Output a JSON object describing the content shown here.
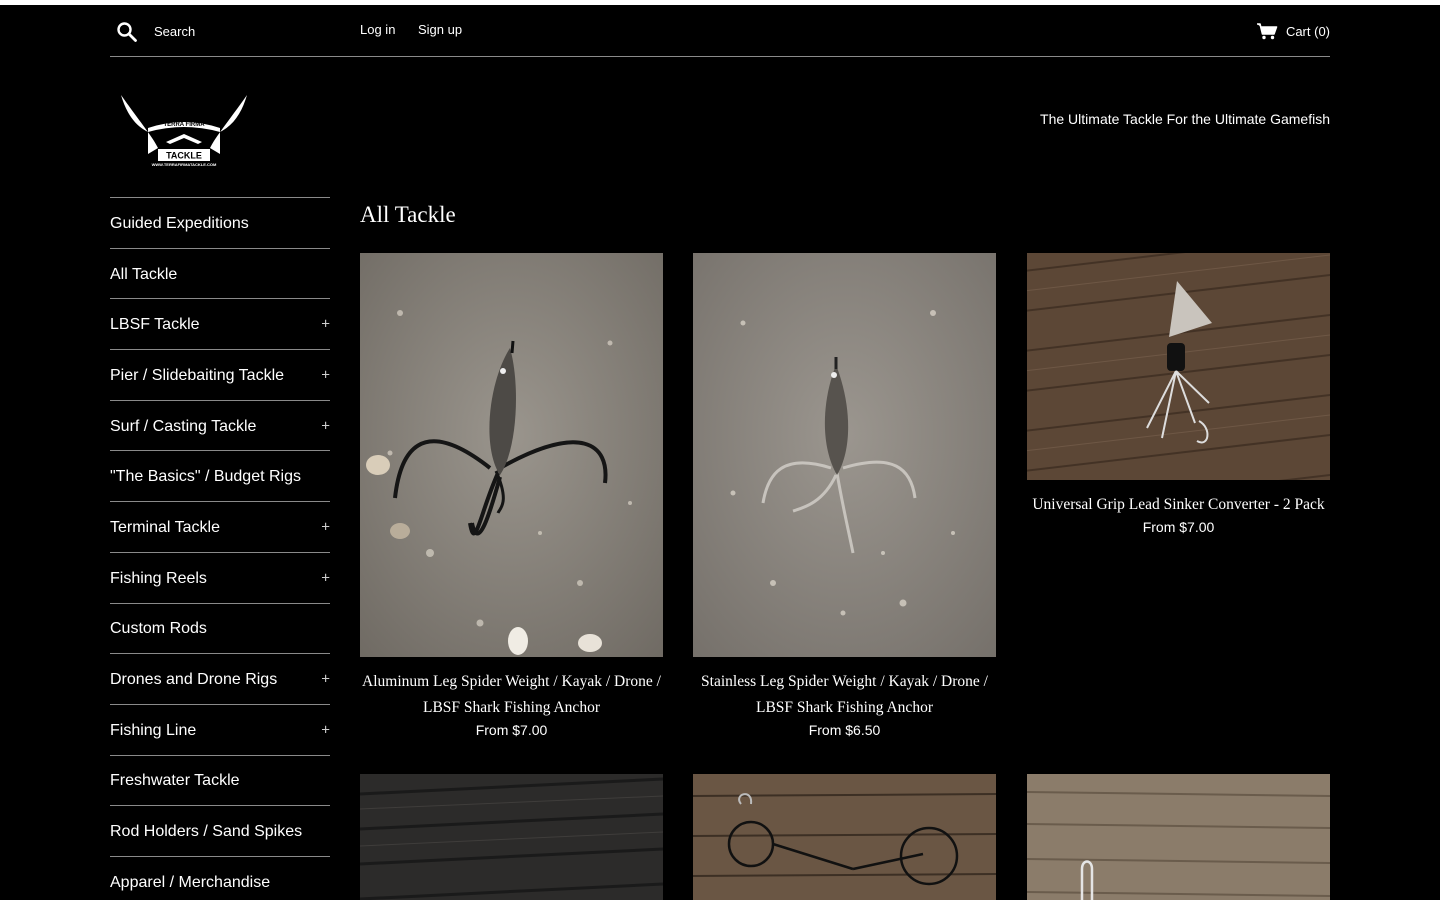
{
  "header": {
    "search_placeholder": "Search",
    "login": "Log in",
    "signup": "Sign up",
    "cart": "Cart (0)"
  },
  "brand": {
    "logo_line1": "TERRA FIRMA",
    "logo_line2": "TACKLE",
    "logo_url_text": "WWW.TERRAFIRMATACKLE.COM",
    "tagline": "The Ultimate Tackle For the Ultimate Gamefish"
  },
  "sidebar": {
    "items": [
      {
        "label": "Guided Expeditions",
        "expandable": false
      },
      {
        "label": "All Tackle",
        "expandable": false
      },
      {
        "label": "LBSF Tackle",
        "expandable": true
      },
      {
        "label": "Pier / Slidebaiting Tackle",
        "expandable": true
      },
      {
        "label": "Surf / Casting Tackle",
        "expandable": true
      },
      {
        "label": "\"The Basics\" / Budget Rigs",
        "expandable": false
      },
      {
        "label": "Terminal Tackle",
        "expandable": true
      },
      {
        "label": "Fishing Reels",
        "expandable": true
      },
      {
        "label": "Custom Rods",
        "expandable": false
      },
      {
        "label": "Drones and Drone Rigs",
        "expandable": true
      },
      {
        "label": "Fishing Line",
        "expandable": true
      },
      {
        "label": "Freshwater Tackle",
        "expandable": false
      },
      {
        "label": "Rod Holders / Sand Spikes",
        "expandable": false
      },
      {
        "label": "Apparel / Merchandise",
        "expandable": false
      }
    ],
    "expand_symbol": "+"
  },
  "main": {
    "title": "All Tackle",
    "products": [
      {
        "name": "Aluminum Leg Spider Weight / Kayak / Drone / LBSF Shark Fishing Anchor",
        "price": "From $7.00"
      },
      {
        "name": "Stainless Leg Spider Weight / Kayak / Drone / LBSF Shark Fishing Anchor",
        "price": "From $6.50"
      },
      {
        "name": "Universal Grip Lead Sinker Converter - 2 Pack",
        "price": "From $7.00"
      }
    ]
  },
  "colors": {
    "background": "#000000",
    "text": "#ffffff",
    "divider": "#8a8a8a",
    "sand": "#8f8a82",
    "wood": "#5a4636"
  }
}
